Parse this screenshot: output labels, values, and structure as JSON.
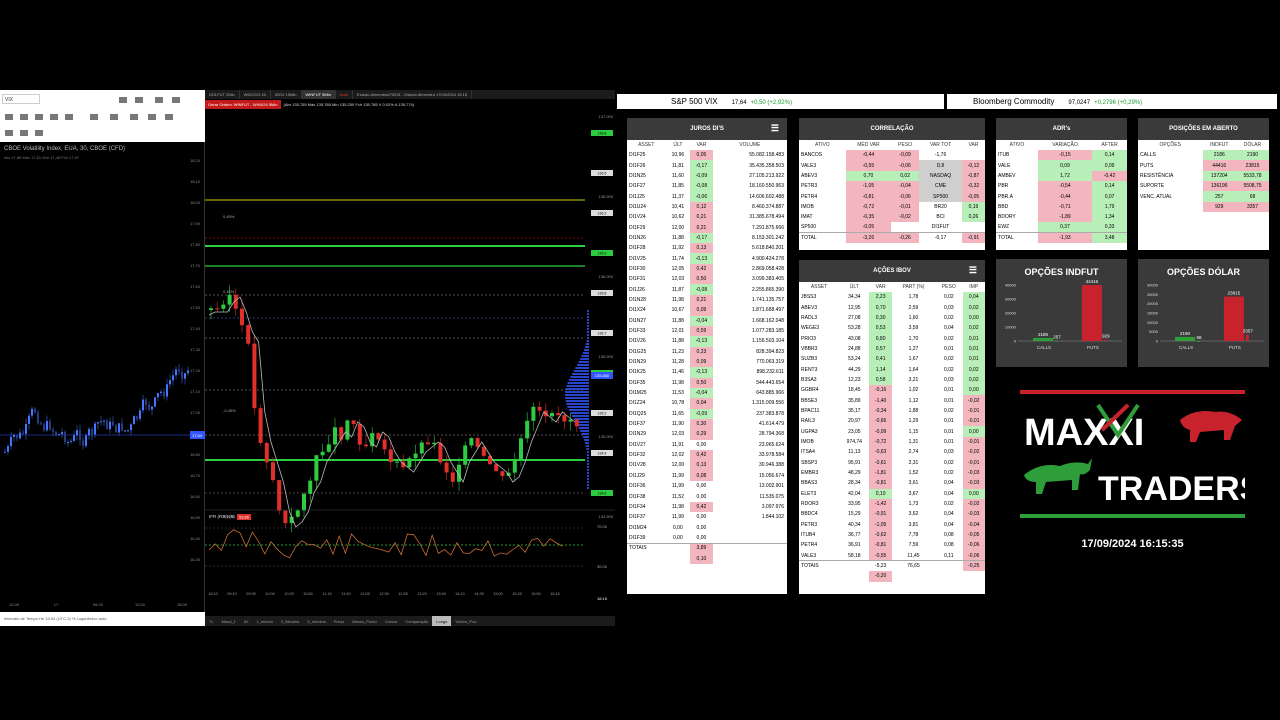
{
  "left_chart": {
    "symbol": "VIX",
    "title": "CBOE Volatility Index, EUA, 30, CBOE (CFD)",
    "ohlc": "Abr 17,88 Máx 17,81 Mín 17,48 Fch 17,57",
    "price_labels": [
      "18,20",
      "18,10",
      "18,00",
      "17,90",
      "17,80",
      "17,70",
      "17,60",
      "17,50",
      "17,40",
      "17,30",
      "17,20",
      "17,10",
      "17,00",
      "16,90",
      "16,80",
      "16,70",
      "16,60",
      "16,50",
      "16,40",
      "16,30"
    ],
    "last_price": "17,64",
    "time_labels": [
      "12:00",
      "17",
      "06:00",
      "12:00",
      "18:00"
    ],
    "footer": "Intervalo de Tempo  Hn 15:54 (UTC-3)  %  Logarítmico  auto"
  },
  "main_chart": {
    "tabs": [
      "DOLFUT 2Min",
      "WDOZ23 4h",
      "IBOV 15Min",
      "WINFUT 5Min",
      "Auto",
      "Estudo Almendra275291 - Estudo Almendra 17/09/2024 16:15"
    ],
    "order_label": "Gerar Ordem: WINFUT - WINV24 5Min",
    "ohlc": "(Abr 135.755 Máx 135.785 Mín 135.250 Fch 135.785 V 0.02% A 135.774)",
    "price_labels": [
      "137.000",
      "136.500",
      "136.000",
      "135.500",
      "135.000",
      "134.500"
    ],
    "level_labels": [
      "136.8",
      "136.5",
      "136.2",
      "135.9",
      "135.8",
      "135.7",
      "135.5",
      "135.2",
      "134.9",
      "134.6"
    ],
    "current_price": "135.850",
    "pct_labels": [
      "0,45%",
      "0,45%",
      "-0,45%",
      "0,95%"
    ],
    "indicator_label": "IFR (RSI) (9)",
    "indicator_value": "53,86",
    "rsi_levels": [
      "70,00",
      "30,00"
    ],
    "time_labels": [
      "18:10",
      "09:10",
      "09:35",
      "10:00",
      "10:25",
      "10:50",
      "11:15",
      "11:40",
      "12:05",
      "12:30",
      "12:55",
      "13:20",
      "13:45",
      "14:10",
      "14:35",
      "15:00",
      "15:25",
      "15:50",
      "16:15"
    ],
    "clock": "16:15",
    "bottom_tabs": [
      "TL",
      "Macd_1",
      "60",
      "1_minuto",
      "2_Minutos",
      "3_minutos",
      "Preço",
      "Mesos_Ponto",
      "Cursos",
      "Comparação",
      "Longo",
      "Vol/ico_Poo"
    ]
  },
  "tickers": [
    {
      "name": "S&P 500 VIX",
      "value": "17,64",
      "change": "+0,50 (+2,92%)"
    },
    {
      "name": "Bloomberg Commodity",
      "value": "97,0247",
      "change": "+0,2796 (+0,29%)"
    }
  ],
  "juros": {
    "title": "JUROS DI'S",
    "menu_icon": "menu-icon",
    "headers": [
      "ASSET",
      "ÚLT",
      "VAR",
      "VOLUME"
    ],
    "rows": [
      [
        "DI1F25",
        "10,96",
        "0,05",
        "55.082.158.483",
        "r"
      ],
      [
        "DI1F26",
        "11,81",
        "-0,17",
        "35.435.358.503",
        "g"
      ],
      [
        "DI1N25",
        "11,60",
        "-0,09",
        "27.105.213.922",
        "g"
      ],
      [
        "DI1F27",
        "11,85",
        "-0,08",
        "18.160.550.963",
        "g"
      ],
      [
        "DI1J25",
        "11,37",
        "-0,06",
        "14.606.602.488",
        "g"
      ],
      [
        "DI1U24",
        "10,41",
        "0,12",
        "8.460.374.887",
        "r"
      ],
      [
        "DI1V24",
        "10,62",
        "0,21",
        "31.385.678.494",
        "r"
      ],
      [
        "DI1F29",
        "12,00",
        "0,21",
        "7.291.875.666",
        "r"
      ],
      [
        "DI1N26",
        "11,88",
        "-0,17",
        "8.153.301.242",
        "g"
      ],
      [
        "DI1F28",
        "11,92",
        "0,13",
        "5.618.840.201",
        "r"
      ],
      [
        "DI1V25",
        "11,74",
        "-0,13",
        "4.900.424.278",
        "g"
      ],
      [
        "DI1F30",
        "12,05",
        "0,42",
        "2.869.058.428",
        "r"
      ],
      [
        "DI1F31",
        "12,03",
        "0,50",
        "3.099.383.405",
        "r"
      ],
      [
        "DI1J26",
        "11,87",
        "-0,08",
        "2.255.865.390",
        "g"
      ],
      [
        "DI1N28",
        "11,98",
        "0,21",
        "1.741.135.757",
        "r"
      ],
      [
        "DI1X24",
        "10,67",
        "0,09",
        "1.871.688.497",
        "r"
      ],
      [
        "DI1N27",
        "11,88",
        "-0,04",
        "1.668.162.048",
        "g"
      ],
      [
        "DI1F33",
        "12,01",
        "0,59",
        "1.077.283.185",
        "r"
      ],
      [
        "DI1V26",
        "11,88",
        "-0,13",
        "1.156.503.104",
        "g"
      ],
      [
        "DI1G25",
        "11,23",
        "0,23",
        "828.394.823",
        "r"
      ],
      [
        "DI1N29",
        "11,28",
        "0,09",
        "770.063.319",
        "r"
      ],
      [
        "DI1K25",
        "11,46",
        "-0,13",
        "898.232.611",
        "g"
      ],
      [
        "DI1F35",
        "11,98",
        "0,50",
        "544.443.654",
        "r"
      ],
      [
        "DI1M25",
        "11,53",
        "-0,04",
        "643.885.966",
        "g"
      ],
      [
        "DI1Z24",
        "10,78",
        "0,04",
        "1.315.009.556",
        "r"
      ],
      [
        "DI1Q25",
        "11,65",
        "-0,09",
        "237.383.878",
        "g"
      ],
      [
        "DI1F37",
        "11,90",
        "0,30",
        "41.614.479",
        "r"
      ],
      [
        "DI1N29",
        "12,03",
        "0,29",
        "28.794.368",
        "r"
      ],
      [
        "DI1V27",
        "11,91",
        "0,00",
        "23.965.624",
        "w"
      ],
      [
        "DI1F32",
        "12,02",
        "0,42",
        "33.978.584",
        "r"
      ],
      [
        "DI1V28",
        "12,00",
        "0,13",
        "30.946.388",
        "r"
      ],
      [
        "DI1J29",
        "11,99",
        "0,08",
        "15.056.674",
        "r"
      ],
      [
        "DI1F36",
        "11,99",
        "0,00",
        "13.002.901",
        "w"
      ],
      [
        "DI1F38",
        "11,52",
        "0,00",
        "11.535.075",
        "w"
      ],
      [
        "DI1F34",
        "11,98",
        "0,42",
        "3.097.976",
        "r"
      ],
      [
        "DI1F37",
        "11,99",
        "0,00",
        "1.844.102",
        "w"
      ],
      [
        "DI1M24",
        "0,00",
        "0,00",
        "",
        "w"
      ],
      [
        "DI1F39",
        "0,00",
        "0,00",
        "",
        "w"
      ]
    ],
    "totals_label": "TOTAIS",
    "totals": [
      "3,89",
      "0,10"
    ]
  },
  "correlacao": {
    "title": "CORRELAÇÃO",
    "headers": [
      "ATIVO",
      "MÉD VAR",
      "PESO",
      "VAR TOT",
      "",
      "VAR"
    ],
    "rows": [
      [
        "BANCOS",
        "-0,44",
        "-0,09",
        "-1,76",
        "",
        "",
        "r",
        "r",
        "",
        "w"
      ],
      [
        "VALE3",
        "-0,55",
        "-0,06",
        "DJI",
        "-0,12",
        "",
        "r",
        "r",
        "gy",
        "r"
      ],
      [
        "ABEV3",
        "0,70",
        "0,02",
        "NASDAQ",
        "-0,87",
        "",
        "g",
        "g",
        "gy",
        "r"
      ],
      [
        "PETR3",
        "-1,05",
        "-0,04",
        "CME",
        "-0,32",
        "",
        "r",
        "r",
        "gy",
        "r"
      ],
      [
        "PETR4",
        "-0,81",
        "-0,06",
        "SP500",
        "-0,05",
        "",
        "r",
        "r",
        "gy",
        "r"
      ],
      [
        "IMOB",
        "-0,72",
        "-0,01",
        "BR20",
        "0,19",
        "",
        "r",
        "r",
        "w",
        "g"
      ],
      [
        "IMAT",
        "-0,35",
        "-0,02",
        "BCI",
        "0,26",
        "",
        "r",
        "r",
        "w",
        "g"
      ],
      [
        "SP500",
        "-0,05",
        "",
        "DI1FUT",
        "",
        "",
        "r",
        "w",
        "w",
        "w"
      ]
    ],
    "total": [
      "TOTAL",
      "-3,26",
      "-0,26",
      "-0,17",
      "-0,91"
    ]
  },
  "adrs": {
    "title": "ADR's",
    "headers": [
      "ATIVO",
      "VARIAÇÃO",
      "AFTER"
    ],
    "rows": [
      [
        "ITUB",
        "-0,15",
        "0,14",
        "r",
        "g"
      ],
      [
        "VALE",
        "0,09",
        "0,09",
        "g",
        "g"
      ],
      [
        "AMBEV",
        "1,72",
        "-0,42",
        "g",
        "r"
      ],
      [
        "PBR",
        "-0,54",
        "0,14",
        "r",
        "g"
      ],
      [
        "PBR.A",
        "-0,44",
        "0,07",
        "r",
        "g"
      ],
      [
        "BBD",
        "-0,71",
        "1,79",
        "r",
        "g"
      ],
      [
        "BDORY",
        "-1,89",
        "1,34",
        "r",
        "g"
      ],
      [
        "EWZ",
        "0,37",
        "0,33",
        "g",
        "g"
      ]
    ],
    "total": [
      "TOTAL",
      "-1,93",
      "3,48"
    ]
  },
  "posicoes": {
    "title": "POSIÇÕES EM ABERTO",
    "headers": [
      "OPÇÕES",
      "INDFUT",
      "DÓLAR"
    ],
    "rows": [
      [
        "CALLS",
        "2186",
        "2190",
        "g",
        "g"
      ],
      [
        "PUTS",
        "44416",
        "23815",
        "r",
        "r"
      ],
      [
        "RESISTÊNCIA",
        "137204",
        "5533,78",
        "g",
        "g"
      ],
      [
        "SUPORTE",
        "136196",
        "5508,75",
        "r",
        "r"
      ]
    ],
    "venc_label": "VENC. ATUAL",
    "venc": [
      [
        "257",
        "68",
        "g",
        "g"
      ],
      [
        "929",
        "3357",
        "r",
        "r"
      ]
    ]
  },
  "acoes": {
    "title": "AÇÕES IBOV",
    "menu_icon": "menu-icon",
    "headers": [
      "ASSET",
      "ÚLT",
      "VAR",
      "PART (%)",
      "PESO",
      "IMP"
    ],
    "rows": [
      [
        "JBSS3",
        "34,34",
        "2,23",
        "1,78",
        "0,02",
        "0,04",
        "g",
        "g"
      ],
      [
        "ABEV3",
        "12,95",
        "0,70",
        "2,59",
        "0,03",
        "0,02",
        "g",
        "g"
      ],
      [
        "RADL3",
        "27,08",
        "0,30",
        "1,60",
        "0,02",
        "0,00",
        "g",
        "g"
      ],
      [
        "WEGE3",
        "53,28",
        "0,53",
        "3,59",
        "0,04",
        "0,02",
        "g",
        "g"
      ],
      [
        "PRIO3",
        "43,08",
        "0,80",
        "1,70",
        "0,02",
        "0,01",
        "g",
        "g"
      ],
      [
        "VBBR3",
        "24,88",
        "0,57",
        "1,27",
        "0,01",
        "0,01",
        "g",
        "g"
      ],
      [
        "SUZB3",
        "53,24",
        "0,41",
        "1,67",
        "0,02",
        "0,01",
        "g",
        "g"
      ],
      [
        "RENT3",
        "44,29",
        "1,14",
        "1,64",
        "0,02",
        "0,02",
        "g",
        "g"
      ],
      [
        "B3SA3",
        "12,23",
        "0,58",
        "3,21",
        "0,03",
        "0,02",
        "g",
        "g"
      ],
      [
        "GGBR4",
        "18,45",
        "-0,16",
        "1,02",
        "0,01",
        "0,00",
        "r",
        "g"
      ],
      [
        "BBSE3",
        "35,89",
        "-1,40",
        "1,12",
        "0,01",
        "-0,02",
        "r",
        "r"
      ],
      [
        "BPAC11",
        "35,17",
        "-0,34",
        "1,88",
        "0,02",
        "-0,01",
        "r",
        "r"
      ],
      [
        "RAIL3",
        "20,97",
        "-0,66",
        "1,29",
        "0,01",
        "-0,01",
        "r",
        "r"
      ],
      [
        "UGPA3",
        "23,05",
        "-0,09",
        "1,15",
        "0,01",
        "0,00",
        "r",
        "g"
      ],
      [
        "IMOB",
        "974,74",
        "-0,72",
        "1,31",
        "0,01",
        "-0,01",
        "r",
        "r"
      ],
      [
        "ITSA4",
        "11,13",
        "-0,63",
        "2,74",
        "0,03",
        "-0,02",
        "r",
        "r"
      ],
      [
        "SBSP3",
        "95,91",
        "-0,61",
        "2,31",
        "0,02",
        "-0,01",
        "r",
        "r"
      ],
      [
        "EMBR3",
        "48,29",
        "-1,81",
        "1,52",
        "0,02",
        "-0,03",
        "r",
        "r"
      ],
      [
        "BBAS3",
        "28,34",
        "-0,81",
        "3,61",
        "0,04",
        "-0,03",
        "r",
        "r"
      ],
      [
        "ELET3",
        "42,04",
        "0,10",
        "3,67",
        "0,04",
        "0,00",
        "g",
        "g"
      ],
      [
        "RDOR3",
        "33,95",
        "-1,42",
        "1,73",
        "0,02",
        "-0,02",
        "r",
        "r"
      ],
      [
        "BBDC4",
        "15,29",
        "-0,91",
        "3,62",
        "0,04",
        "-0,03",
        "r",
        "r"
      ],
      [
        "PETR3",
        "40,34",
        "-1,05",
        "3,81",
        "0,04",
        "-0,04",
        "r",
        "r"
      ],
      [
        "ITUB4",
        "36,77",
        "-0,62",
        "7,78",
        "0,08",
        "-0,05",
        "r",
        "r"
      ],
      [
        "PETR4",
        "36,91",
        "-0,81",
        "7,59",
        "0,08",
        "-0,06",
        "r",
        "r"
      ],
      [
        "VALE3",
        "58,18",
        "-0,55",
        "11,45",
        "0,11",
        "-0,06",
        "r",
        "r"
      ]
    ],
    "totals_label": "TOTAIS",
    "totals": [
      "-5,23",
      "76,65",
      "-0,25"
    ],
    "totals2": "-0,20"
  },
  "opcoes_indfut": {
    "title": "OPÇÕES INDFUT",
    "chart_data": {
      "type": "bar",
      "categories": [
        "CALLS",
        "PUTS"
      ],
      "series": [
        {
          "values": [
            2186,
            44416
          ]
        },
        {
          "values": [
            257,
            929
          ]
        }
      ],
      "ylim": [
        0,
        40000
      ],
      "yticks": [
        "40000",
        "30000",
        "20000",
        "10000",
        "0"
      ]
    }
  },
  "opcoes_dolar": {
    "title": "OPÇÕES DÓLAR",
    "chart_data": {
      "type": "bar",
      "categories": [
        "CALLS",
        "PUTS"
      ],
      "series": [
        {
          "values": [
            2190,
            23815
          ]
        },
        {
          "values": [
            68,
            3357
          ]
        }
      ],
      "ylim": [
        0,
        30000
      ],
      "yticks": [
        "30000",
        "25000",
        "20000",
        "15000",
        "10000",
        "5000",
        "0"
      ]
    }
  },
  "brand": {
    "logo_top": "MAXXI",
    "logo_bottom": "TRADERS",
    "bull_icon": "bull-icon",
    "bear_icon": "bear-icon"
  },
  "datetime": "17/09/2024 16:15:35",
  "colors": {
    "up": "#2e9e3a",
    "down": "#c8232c",
    "panel_header": "#3a3a3a",
    "pos": "#b8efb8",
    "neg": "#f3b6bf"
  }
}
